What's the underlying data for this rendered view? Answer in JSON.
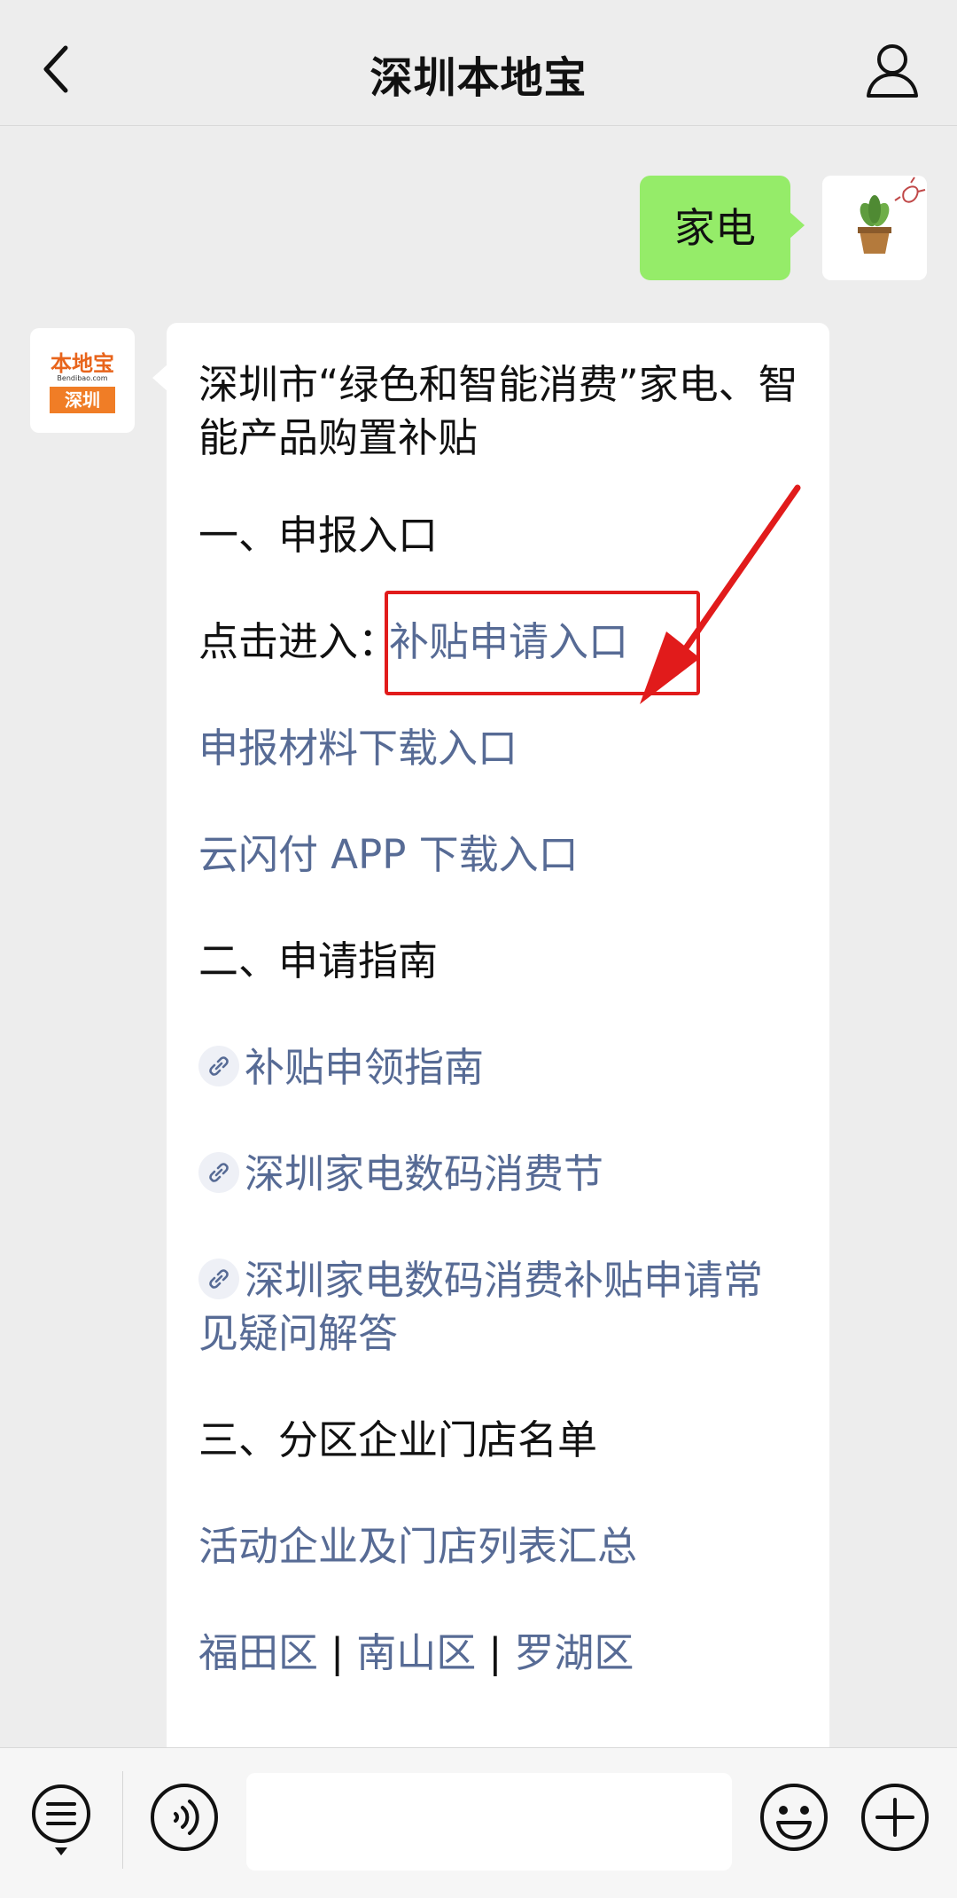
{
  "header": {
    "title": "深圳本地宝",
    "back_icon": "chevron-left-icon",
    "profile_icon": "person-icon"
  },
  "outgoing_message": {
    "text": "家电"
  },
  "bot_avatar": {
    "brand": "本地宝",
    "domain": "Bendibao.com",
    "city": "深圳"
  },
  "incoming_message": {
    "title": "深圳市“绿色和智能消费”家电、智能产品购置补贴",
    "section1_heading": "一、申报入口",
    "click_prefix": "点击进入：",
    "apply_link": "补贴申请入口",
    "materials_link": "申报材料下载入口",
    "app_link": "云闪付 APP 下载入口",
    "section2_heading": "二、申请指南",
    "guide_links": [
      "补贴申领指南",
      "深圳家电数码消费节",
      "深圳家电数码消费补贴申请常见疑问解答"
    ],
    "section3_heading": "三、分区企业门店名单",
    "stores_link": "活动企业及门店列表汇总",
    "district_links": [
      "福田区",
      "南山区",
      "罗湖区"
    ],
    "district_separator": "|"
  },
  "input_bar": {
    "menu_icon": "list-menu-icon",
    "voice_icon": "voice-icon",
    "emoji_icon": "emoji-icon",
    "plus_icon": "plus-icon"
  },
  "colors": {
    "link": "#576b95",
    "outgoing_bubble": "#95ec69",
    "highlight": "#e11b1b",
    "background": "#ededed"
  }
}
